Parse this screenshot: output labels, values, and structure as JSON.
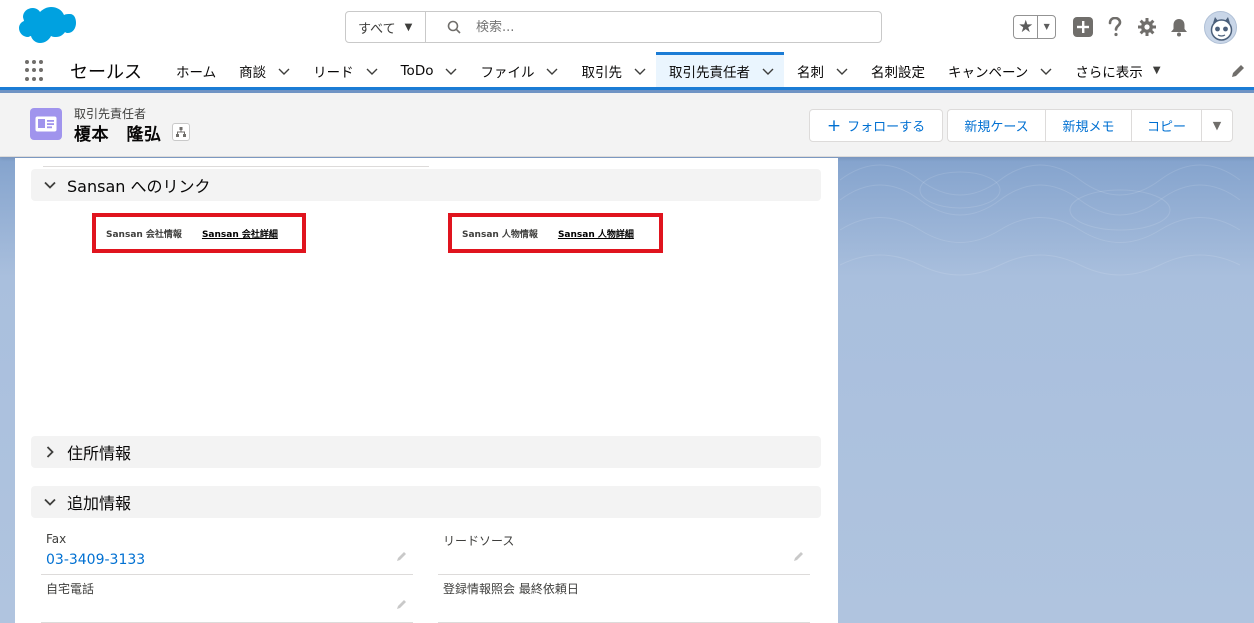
{
  "header": {
    "search_scope": "すべて",
    "search_placeholder": "検索..."
  },
  "nav": {
    "app_name": "セールス",
    "items": [
      {
        "label": "ホーム"
      },
      {
        "label": "商談"
      },
      {
        "label": "リード"
      },
      {
        "label": "ToDo"
      },
      {
        "label": "ファイル"
      },
      {
        "label": "取引先"
      },
      {
        "label": "取引先責任者"
      },
      {
        "label": "名刺"
      },
      {
        "label": "名刺設定"
      },
      {
        "label": "キャンペーン"
      },
      {
        "label": "さらに表示"
      }
    ]
  },
  "record": {
    "object_type": "取引先責任者",
    "name": "榎本　隆弘",
    "actions": {
      "follow": "フォローする",
      "new_case": "新規ケース",
      "new_memo": "新規メモ",
      "copy": "コピー"
    }
  },
  "sections": {
    "sansan": {
      "title": "Sansan へのリンク",
      "company_label": "Sansan 会社情報",
      "company_link": "Sansan 会社詳細",
      "person_label": "Sansan 人物情報",
      "person_link": "Sansan 人物詳細"
    },
    "address": {
      "title": "住所情報"
    },
    "additional": {
      "title": "追加情報",
      "fields": {
        "fax_label": "Fax",
        "fax_value": "03-3409-3133",
        "lead_source_label": "リードソース",
        "home_phone_label": "自宅電話",
        "last_request_label": "登録情報照会 最終依頼日"
      }
    }
  },
  "colors": {
    "brand_blue": "#1b7cd5",
    "link_blue": "#0070d2",
    "highlight_red": "#e0141e",
    "contact_icon": "#a094ed",
    "salesforce_cloud": "#00a1e0"
  }
}
